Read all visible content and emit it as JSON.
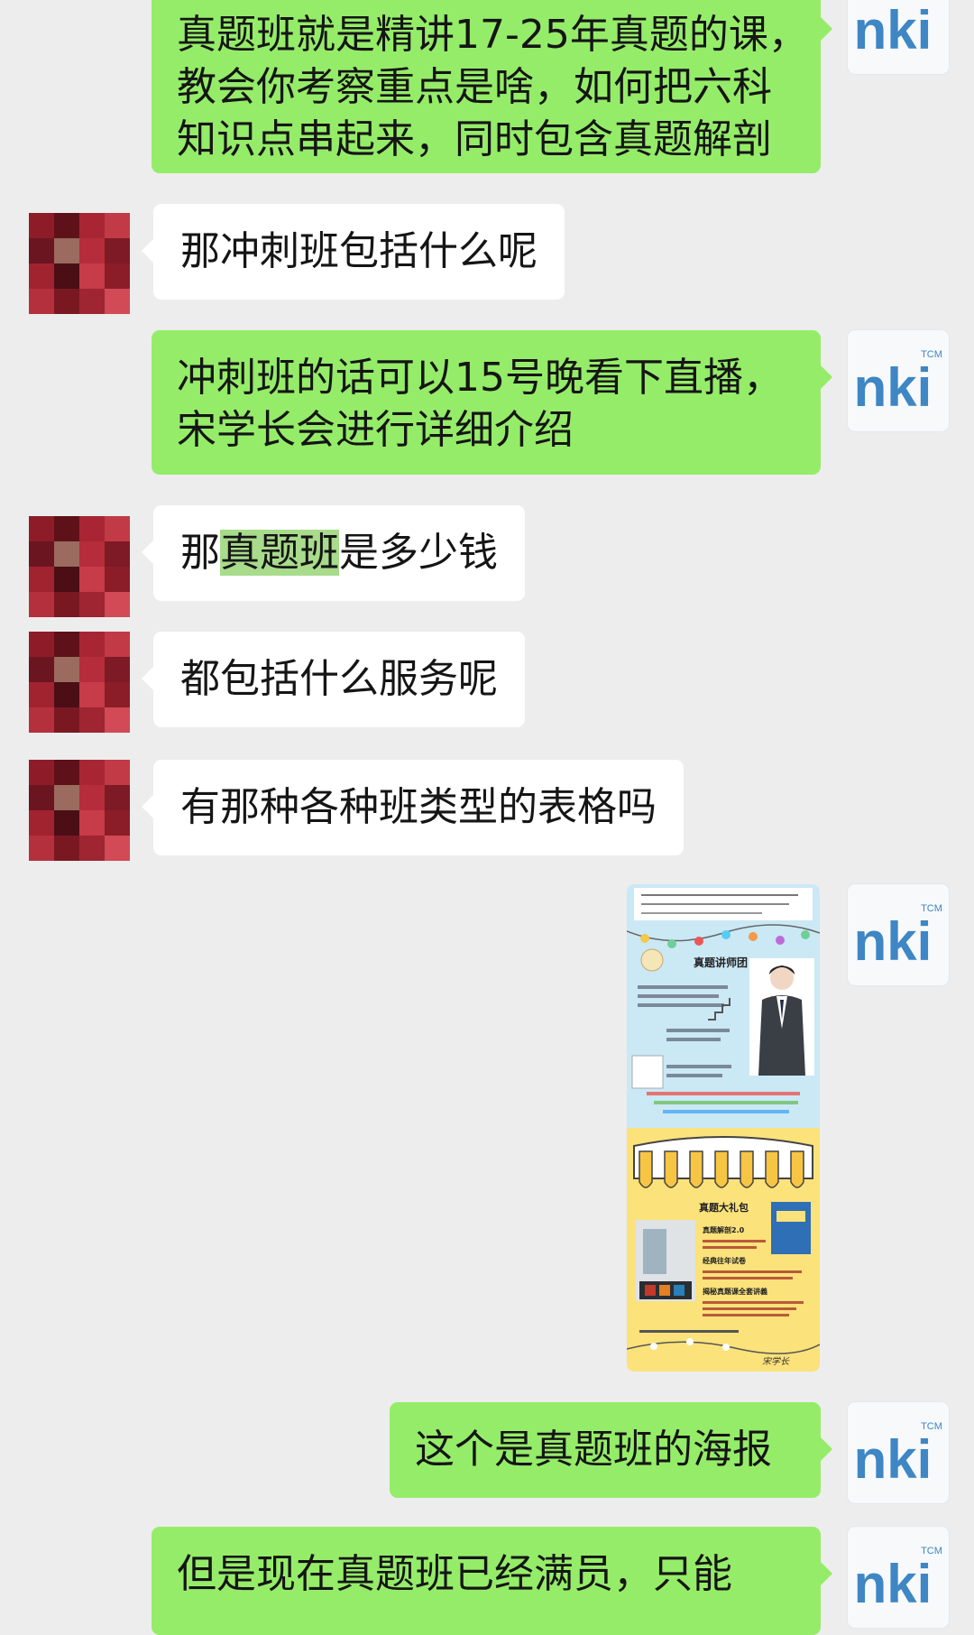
{
  "self_avatar": {
    "icon": "nki-logo-avatar-icon",
    "text": "nki",
    "sub": "TCM"
  },
  "messages": [
    {
      "id": "m1",
      "side": "out",
      "lines": [
        "真题班就是精讲17-25年真题的课，",
        "教会你考察重点是啥，如何把六科",
        "知识点串起来，同时包含真题解剖"
      ]
    },
    {
      "id": "m2",
      "side": "in",
      "text": "那冲刺班包括什么呢"
    },
    {
      "id": "m3",
      "side": "out",
      "lines": [
        "冲刺班的话可以15号晚看下直播，",
        "宋学长会进行详细介绍"
      ]
    },
    {
      "id": "m4",
      "side": "in",
      "pre": "那",
      "highlight": "真题班",
      "post": "是多少钱"
    },
    {
      "id": "m5",
      "side": "in",
      "text": "都包括什么服务呢"
    },
    {
      "id": "m6",
      "side": "in",
      "text": "有那种各种班类型的表格吗"
    },
    {
      "id": "m7",
      "side": "out",
      "type": "image",
      "poster": {
        "section1_title": "真题讲师团",
        "section2_title": "真题大礼包",
        "items": [
          "真题解剖2.0",
          "经典往年试卷",
          "揭秘真题课全套讲義"
        ],
        "signature": "宋学长"
      }
    },
    {
      "id": "m8",
      "side": "out",
      "text": "这个是真题班的海报"
    },
    {
      "id": "m9",
      "side": "out",
      "text": "但是现在真题班已经满员，只能"
    }
  ],
  "colors": {
    "background": "#ededed",
    "outgoing_bubble": "#95ec69",
    "incoming_bubble": "#ffffff",
    "highlight": "#a8db8b",
    "logo": "#3e86c4"
  }
}
